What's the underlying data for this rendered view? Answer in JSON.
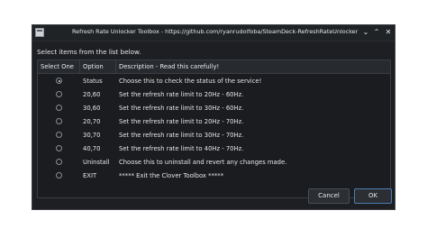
{
  "window": {
    "title": "Refresh Rate Unlocker Toolbox - https://github.com/ryanrudolfoba/SteamDeck-RefreshRateUnlocker",
    "controls": {
      "minimize": "⌄",
      "maximize": "⌃",
      "close": "✕"
    }
  },
  "prompt": "Select items from the list below.",
  "table": {
    "headers": [
      "Select One",
      "Option",
      "Description - Read this carefully!"
    ],
    "rows": [
      {
        "selected": true,
        "option": "Status",
        "description": "Choose this to check the status of the service!"
      },
      {
        "selected": false,
        "option": "20,60",
        "description": "Set the refresh rate limit to 20Hz - 60Hz."
      },
      {
        "selected": false,
        "option": "30,60",
        "description": "Set the refresh rate limit to 30Hz - 60Hz."
      },
      {
        "selected": false,
        "option": "20,70",
        "description": "Set the refresh rate limit to 20Hz - 70Hz."
      },
      {
        "selected": false,
        "option": "30,70",
        "description": "Set the refresh rate limit to 30Hz - 70Hz."
      },
      {
        "selected": false,
        "option": "40,70",
        "description": "Set the refresh rate limit to 40Hz - 70Hz."
      },
      {
        "selected": false,
        "option": "Uninstall",
        "description": "Choose this to uninstall and revert any changes made."
      },
      {
        "selected": false,
        "option": "EXIT",
        "description": "***** Exit the Clover Toolbox *****"
      }
    ]
  },
  "buttons": {
    "cancel": "Cancel",
    "ok": "OK"
  },
  "colors": {
    "window_bg": "#1d1f22",
    "accent": "#4b7fb5"
  }
}
